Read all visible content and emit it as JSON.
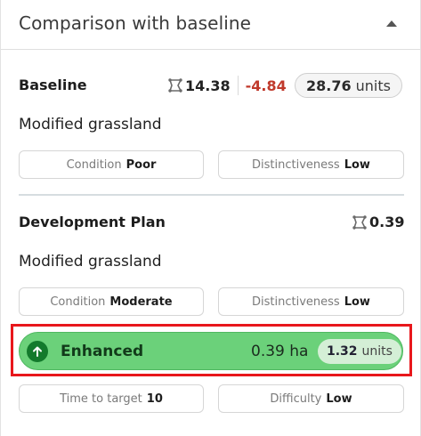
{
  "header": {
    "title": "Comparison with baseline"
  },
  "baseline": {
    "title": "Baseline",
    "area": "14.38",
    "change": "-4.84",
    "units_value": "28.76",
    "units_label": "units",
    "habitat": "Modified grassland",
    "condition_label": "Condition",
    "condition_value": "Poor",
    "distinctiveness_label": "Distinctiveness",
    "distinctiveness_value": "Low"
  },
  "plan": {
    "title": "Development Plan",
    "area": "0.39",
    "habitat": "Modified grassland",
    "condition_label": "Condition",
    "condition_value": "Moderate",
    "distinctiveness_label": "Distinctiveness",
    "distinctiveness_value": "Low"
  },
  "enhanced": {
    "label": "Enhanced",
    "area": "0.39 ha",
    "units_value": "1.32",
    "units_label": "units",
    "color": "#6bd17a"
  },
  "targets": {
    "time_label": "Time to target",
    "time_value": "10",
    "difficulty_label": "Difficulty",
    "difficulty_value": "Low"
  },
  "icons": {
    "collapse": "chevron-up-icon",
    "area": "polygon-area-icon",
    "enhanced": "arrow-up-icon"
  }
}
